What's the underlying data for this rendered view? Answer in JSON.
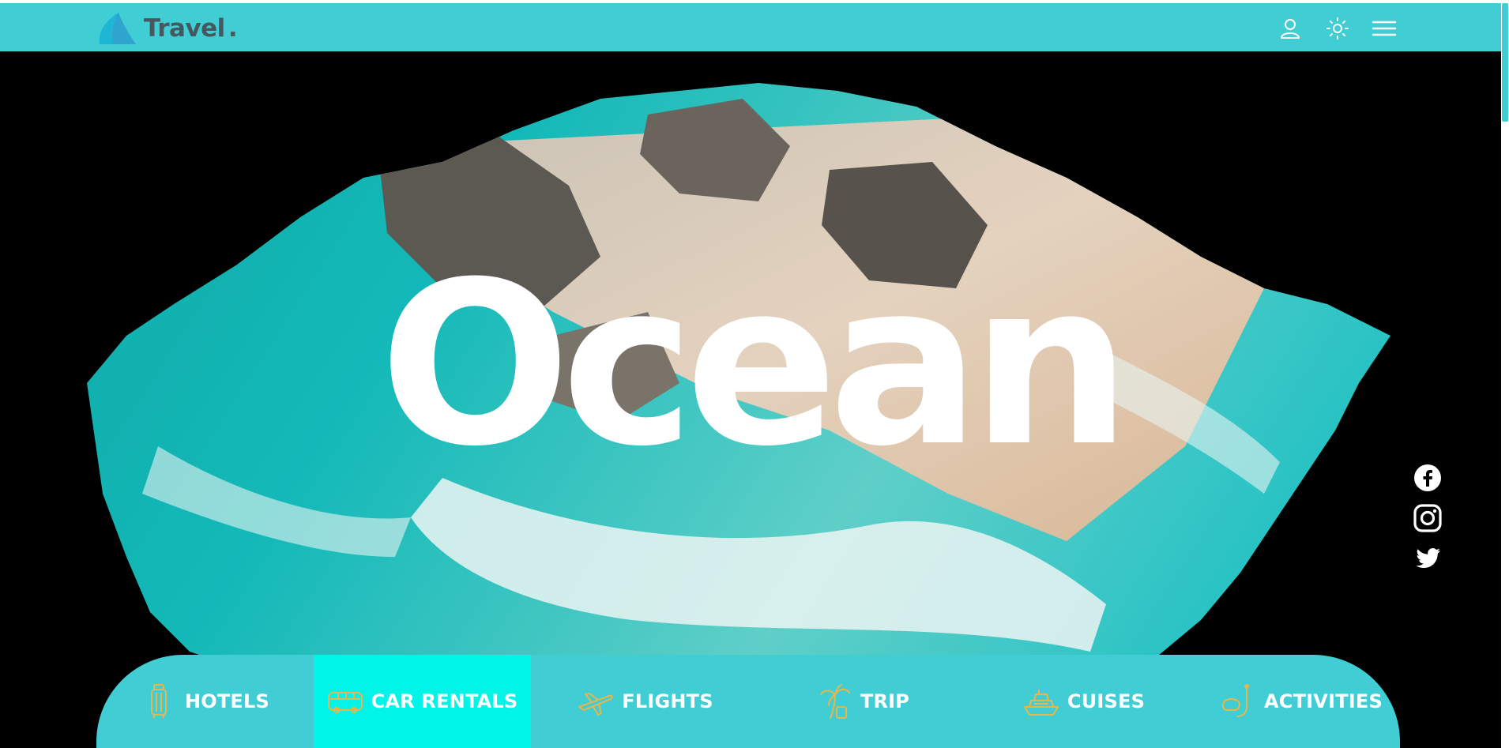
{
  "brand": {
    "name": "Travel",
    "dot": "."
  },
  "header_icons": [
    "user-icon",
    "sun-icon",
    "menu-icon"
  ],
  "hero": {
    "title": "Ocean"
  },
  "social": [
    "facebook-icon",
    "instagram-icon",
    "twitter-icon"
  ],
  "nav": {
    "items": [
      {
        "label": "HOTELS",
        "icon": "luggage-icon"
      },
      {
        "label": "CAR RENTALS",
        "icon": "bus-icon",
        "active": true
      },
      {
        "label": "FLIGHTS",
        "icon": "plane-icon"
      },
      {
        "label": "TRIP",
        "icon": "palm-tree-icon"
      },
      {
        "label": "CUISES",
        "icon": "ship-icon"
      },
      {
        "label": "ACTIVITIES",
        "icon": "snorkel-icon"
      }
    ]
  },
  "colors": {
    "accent": "#40ced4",
    "active": "#00f5e7",
    "icon_gold": "#e8b64a",
    "logo_text": "#45575f"
  }
}
